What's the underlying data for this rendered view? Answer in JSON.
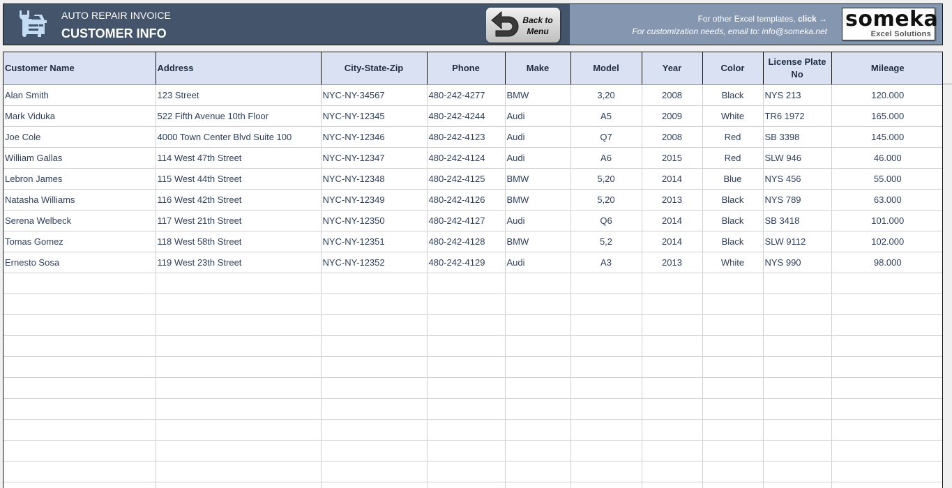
{
  "header": {
    "app_title": "AUTO REPAIR INVOICE",
    "page_title": "CUSTOMER INFO",
    "back_button": {
      "line1": "Back to",
      "line2": "Menu"
    },
    "info_line_1_prefix": "For other Excel templates, ",
    "info_line_1_link": "click →",
    "info_line_2": "For customization needs, email to: info@someka.net",
    "logo": {
      "word": "someka",
      "subtitle": "Excel Solutions"
    },
    "colors": {
      "banner_dark": "#44546a",
      "banner_light": "#8496b0",
      "header_fill": "#d9e1f2"
    }
  },
  "table": {
    "columns": [
      "Customer Name",
      "Address",
      "City-State-Zip",
      "Phone",
      "Make",
      "Model",
      "Year",
      "Color",
      "License Plate No",
      "Mileage"
    ],
    "rows": [
      [
        "Alan Smith",
        "123 Street",
        "NYC-NY-34567",
        "480-242-4277",
        "BMW",
        "3,20",
        "2008",
        "Black",
        "NYS 213",
        "120.000"
      ],
      [
        "Mark Viduka",
        "522 Fifth Avenue 10th Floor",
        "NYC-NY-12345",
        "480-242-4244",
        "Audi",
        "A5",
        "2009",
        "White",
        "TR6 1972",
        "165.000"
      ],
      [
        "Joe Cole",
        "4000 Town Center Blvd Suite 100",
        "NYC-NY-12346",
        "480-242-4123",
        "Audi",
        "Q7",
        "2008",
        "Red",
        "SB 3398",
        "145.000"
      ],
      [
        "William Gallas",
        "114 West 47th Street",
        "NYC-NY-12347",
        "480-242-4124",
        "Audi",
        "A6",
        "2015",
        "Red",
        "SLW 946",
        "46.000"
      ],
      [
        "Lebron James",
        "115 West 44th Street",
        "NYC-NY-12348",
        "480-242-4125",
        "BMW",
        "5,20",
        "2014",
        "Blue",
        "NYS 456",
        "55.000"
      ],
      [
        "Natasha Williams",
        "116 West 42th Street",
        "NYC-NY-12349",
        "480-242-4126",
        "BMW",
        "5,20",
        "2013",
        "Black",
        "NYS 789",
        "63.000"
      ],
      [
        "Serena Welbeck",
        "117 West 21th Street",
        "NYC-NY-12350",
        "480-242-4127",
        "Audi",
        "Q6",
        "2014",
        "Black",
        "SB 3418",
        "101.000"
      ],
      [
        "Tomas Gomez",
        "118 West 58th Street",
        "NYC-NY-12351",
        "480-242-4128",
        "BMW",
        "5,2",
        "2014",
        "Black",
        "SLW 9112",
        "102.000"
      ],
      [
        "Ernesto Sosa",
        "119 West 23th Street",
        "NYC-NY-12352",
        "480-242-4129",
        "Audi",
        "A3",
        "2013",
        "White",
        "NYS 990",
        "98.000"
      ]
    ],
    "empty_rows": 11
  }
}
